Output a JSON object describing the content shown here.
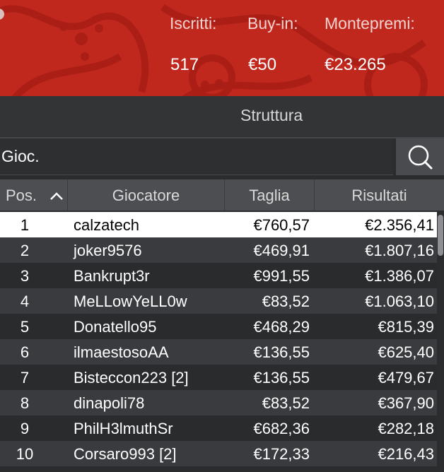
{
  "header": {
    "entrants_label": "Iscritti:",
    "entrants_value": "517",
    "buyin_label": "Buy-in:",
    "buyin_value": "€50",
    "prizepool_label": "Montepremi:",
    "prizepool_value": "€23.265"
  },
  "tabs": {
    "active_label": "Struttura"
  },
  "search": {
    "placeholder": "Gioc.",
    "icon": "search-icon"
  },
  "table": {
    "columns": [
      "Pos.",
      "Giocatore",
      "Taglia",
      "Risultati"
    ],
    "sort_icon": "chevron-up-icon",
    "rows": [
      {
        "pos": "1",
        "player": "calzatech",
        "stake": "€760,57",
        "result": "€2.356,41"
      },
      {
        "pos": "2",
        "player": "joker9576",
        "stake": "€469,91",
        "result": "€1.807,16"
      },
      {
        "pos": "3",
        "player": "Bankrupt3r",
        "stake": "€991,55",
        "result": "€1.386,07"
      },
      {
        "pos": "4",
        "player": "MeLLowYeLL0w",
        "stake": "€83,52",
        "result": "€1.063,10"
      },
      {
        "pos": "5",
        "player": "Donatello95",
        "stake": "€468,29",
        "result": "€815,39"
      },
      {
        "pos": "6",
        "player": "ilmaestosoAA",
        "stake": "€136,55",
        "result": "€625,40"
      },
      {
        "pos": "7",
        "player": "Bisteccon223 [2]",
        "stake": "€136,55",
        "result": "€479,67"
      },
      {
        "pos": "8",
        "player": "dinapoli78",
        "stake": "€83,52",
        "result": "€367,90"
      },
      {
        "pos": "9",
        "player": "PhilH3lmuthSr",
        "stake": "€682,36",
        "result": "€282,18"
      },
      {
        "pos": "10",
        "player": "Corsaro993 [2]",
        "stake": "€172,33",
        "result": "€216,43"
      }
    ]
  },
  "colors": {
    "banner": "#c0281e",
    "header_row": "#4d4e51",
    "row_even": "#3a3b3e",
    "row_odd": "#2a2b2d",
    "selected_row": "#ffffff"
  }
}
